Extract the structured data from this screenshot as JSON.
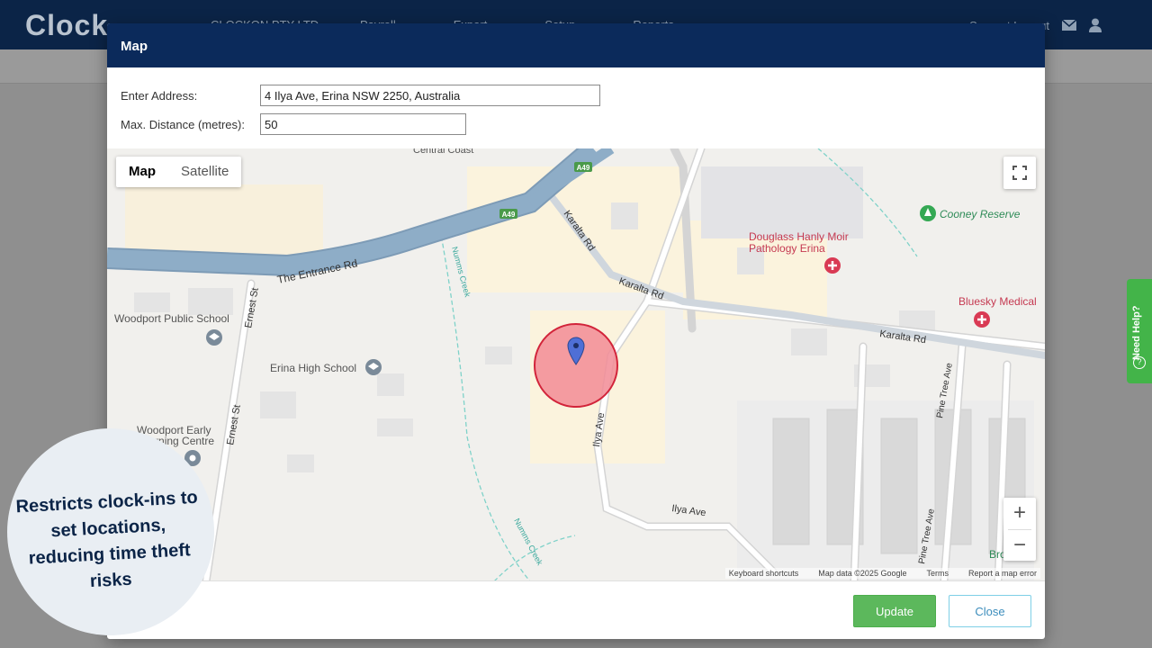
{
  "app": {
    "logo_text": "Clock",
    "company": "CLOCKON PTY LTD",
    "nav": [
      "Payroll",
      "Export",
      "Setup",
      "Reports"
    ],
    "account_text": "Support  Logout"
  },
  "help": {
    "label": "Need Help?"
  },
  "modal": {
    "title": "Map",
    "address_label": "Enter Address:",
    "address_value": "4 Ilya Ave, Erina NSW 2250, Australia",
    "distance_label": "Max. Distance (metres):",
    "distance_value": "50",
    "update_label": "Update",
    "close_label": "Close"
  },
  "map": {
    "type_map": "Map",
    "type_satellite": "Satellite",
    "zoom_in": "+",
    "zoom_out": "−",
    "labels": {
      "central_coast": "Central Coast",
      "entrance_rd": "The Entrance Rd",
      "a49_a": "A49",
      "a49_b": "A49",
      "karalta_rd_1": "Karalta Rd",
      "karalta_rd_2": "Karalta Rd",
      "karalta_rd_3": "Karalta Rd",
      "numms_creek_1": "Numms Creek",
      "numms_creek_2": "Numms Creek",
      "ernest_st_1": "Ernest St",
      "ernest_st_2": "Ernest St",
      "woodport_public": "Woodport Public School",
      "erina_high": "Erina High School",
      "woodport_early_1": "Woodport Early",
      "woodport_early_2": "Learning Centre",
      "douglass_1": "Douglass Hanly Moir",
      "douglass_2": "Pathology Erina",
      "bluesky": "Bluesky Medical",
      "cooney": "Cooney Reserve",
      "ilya_ave_1": "Ilya Ave",
      "ilya_ave_2": "Ilya Ave",
      "pine_tree_1": "Pine Tree Ave",
      "pine_tree_2": "Pine Tree Ave",
      "brown": "Bro"
    },
    "attribution": {
      "shortcuts": "Keyboard shortcuts",
      "data": "Map data ©2025 Google",
      "terms": "Terms",
      "report": "Report a map error"
    },
    "colors": {
      "road_major": "#8eadc7",
      "radius_fill": "#f28b95",
      "radius_stroke": "#d2243a",
      "pin": "#4f6fd6",
      "poi_medical": "#d93a54",
      "poi_park": "#34a853",
      "poi_school": "#7a8a99"
    }
  },
  "callout": {
    "text": "Restricts clock-ins to set locations, reducing time theft risks"
  }
}
